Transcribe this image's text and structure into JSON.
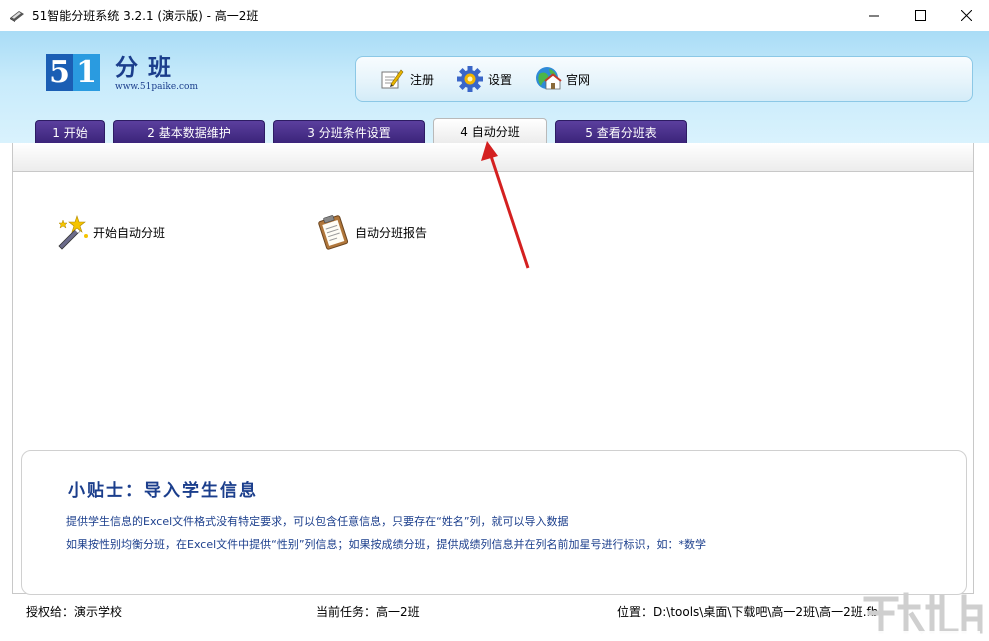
{
  "window": {
    "title": "51智能分班系统 3.2.1 (演示版) - 高一2班",
    "minimize": "—",
    "maximize": "☐",
    "close": "✕"
  },
  "logo": {
    "digit1": "5",
    "digit2": "1",
    "title": "分班",
    "url": "www.51paike.com"
  },
  "toolbar": {
    "items": [
      {
        "label": "注册",
        "icon": "register-icon"
      },
      {
        "label": "设置",
        "icon": "gear-icon"
      },
      {
        "label": "官网",
        "icon": "website-icon"
      }
    ]
  },
  "tabs": [
    {
      "label": "1 开始"
    },
    {
      "label": "2 基本数据维护"
    },
    {
      "label": "3 分班条件设置"
    },
    {
      "label": "4 自动分班",
      "active": true
    },
    {
      "label": "5 查看分班表"
    }
  ],
  "actions": {
    "start_auto": "开始自动分班",
    "report": "自动分班报告"
  },
  "tips": {
    "title": "小贴士：导入学生信息",
    "line1": "提供学生信息的Excel文件格式没有特定要求，可以包含任意信息，只要存在“姓名”列，就可以导入数据",
    "line2": "如果按性别均衡分班，在Excel文件中提供“性别”列信息；如果按成绩分班，提供成绩列信息并在列名前加星号进行标识，如：*数学"
  },
  "status": {
    "licensed": "授权给：演示学校",
    "task": "当前任务：高一2班",
    "location": "位置：D:\\tools\\桌面\\下载吧\\高一2班\\高一2班.fb"
  },
  "colors": {
    "header_bg": "#c8ebfb",
    "tab_bg": "#3b247a",
    "brand_blue": "#1b3e8c",
    "arrow": "#d42020"
  }
}
